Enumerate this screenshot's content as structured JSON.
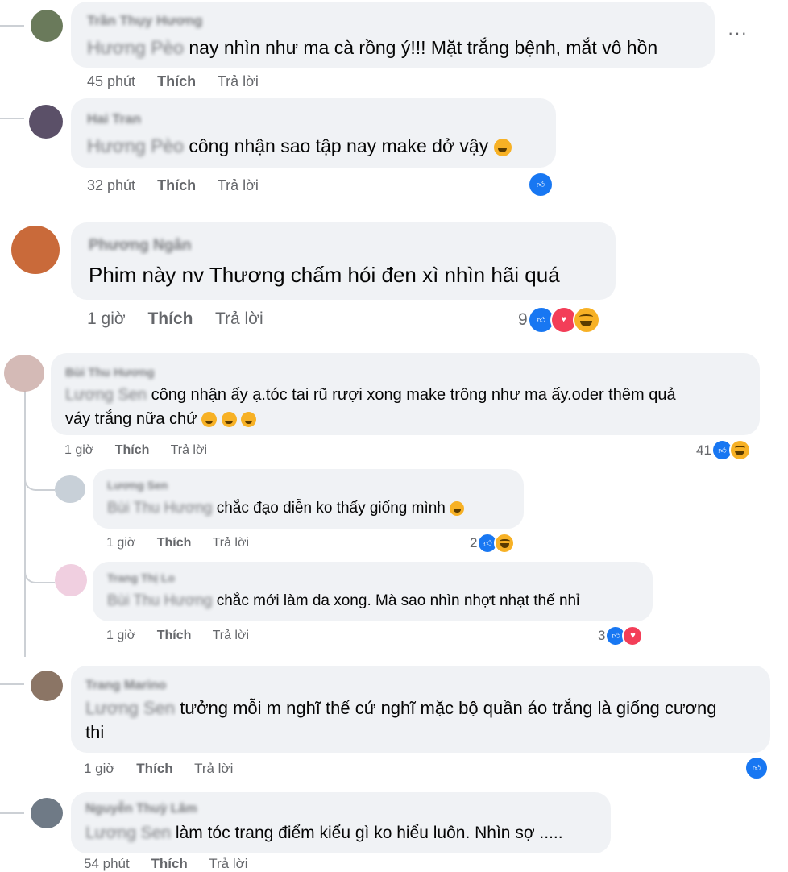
{
  "comments": [
    {
      "author": "Trần Thụy Hương",
      "mention": "Hương Pèo",
      "text": "nay nhìn như ma cà rồng ý!!! Mặt trắng bệnh, mắt vô hồn",
      "time": "45 phút",
      "like_label": "Thích",
      "reply_label": "Trả lời"
    },
    {
      "author": "Hai Tran",
      "mention": "Hương Pèo",
      "text": "công nhận sao tập nay make dở vậy",
      "time": "32 phút",
      "like_label": "Thích",
      "reply_label": "Trả lời"
    },
    {
      "author": "Phương Ngân",
      "text": "Phim này nv Thương chấm hói đen xì nhìn hãi quá",
      "time": "1 giờ",
      "like_label": "Thích",
      "reply_label": "Trả lời",
      "reaction_count": "9"
    },
    {
      "author": "Bùi Thu Hương",
      "mention": "Lương Sen",
      "text_line1": "công nhận ấy ạ.tóc tai rũ rượi xong make trông như ma ấy.oder thêm quả",
      "text_line2": "váy trắng nữa chứ",
      "time": "1 giờ",
      "like_label": "Thích",
      "reply_label": "Trả lời",
      "reaction_count": "41"
    },
    {
      "author": "Lương Sen",
      "mention": "Bùi Thu Hương",
      "text": "chắc đạo diễn ko thấy giống mình",
      "time": "1 giờ",
      "like_label": "Thích",
      "reply_label": "Trả lời",
      "reaction_count": "2"
    },
    {
      "author": "Trang Thị Lo",
      "mention": "Bùi Thu Hương",
      "text": "chắc mới làm da xong. Mà sao nhìn nhợt nhạt thế nhỉ",
      "time": "1 giờ",
      "like_label": "Thích",
      "reply_label": "Trả lời",
      "reaction_count": "3"
    },
    {
      "author": "Trang Marino",
      "mention": "Lương Sen",
      "text_line1": "tưởng mỗi m nghĩ thế cứ nghĩ mặc bộ quần áo trắng là giống cương",
      "text_line2": "thi",
      "time": "1 giờ",
      "like_label": "Thích",
      "reply_label": "Trả lời"
    },
    {
      "author": "Nguyễn Thuỳ Lâm",
      "mention": "Lương Sen",
      "text": "làm tóc trang điểm kiểu gì ko hiểu luôn. Nhìn sợ .....",
      "time": "54 phút",
      "like_label": "Thích",
      "reply_label": "Trả lời"
    }
  ],
  "more_options_label": "···",
  "icons": {
    "like": "like-reaction-icon",
    "love": "love-reaction-icon",
    "haha": "haha-reaction-icon",
    "sad": "sad-reaction-icon",
    "more": "more-options-icon"
  },
  "colors": {
    "like": "#1877f2",
    "love": "#f33e58",
    "haha": "#f7b125",
    "bubble": "#f0f2f5",
    "meta": "#65676b"
  }
}
